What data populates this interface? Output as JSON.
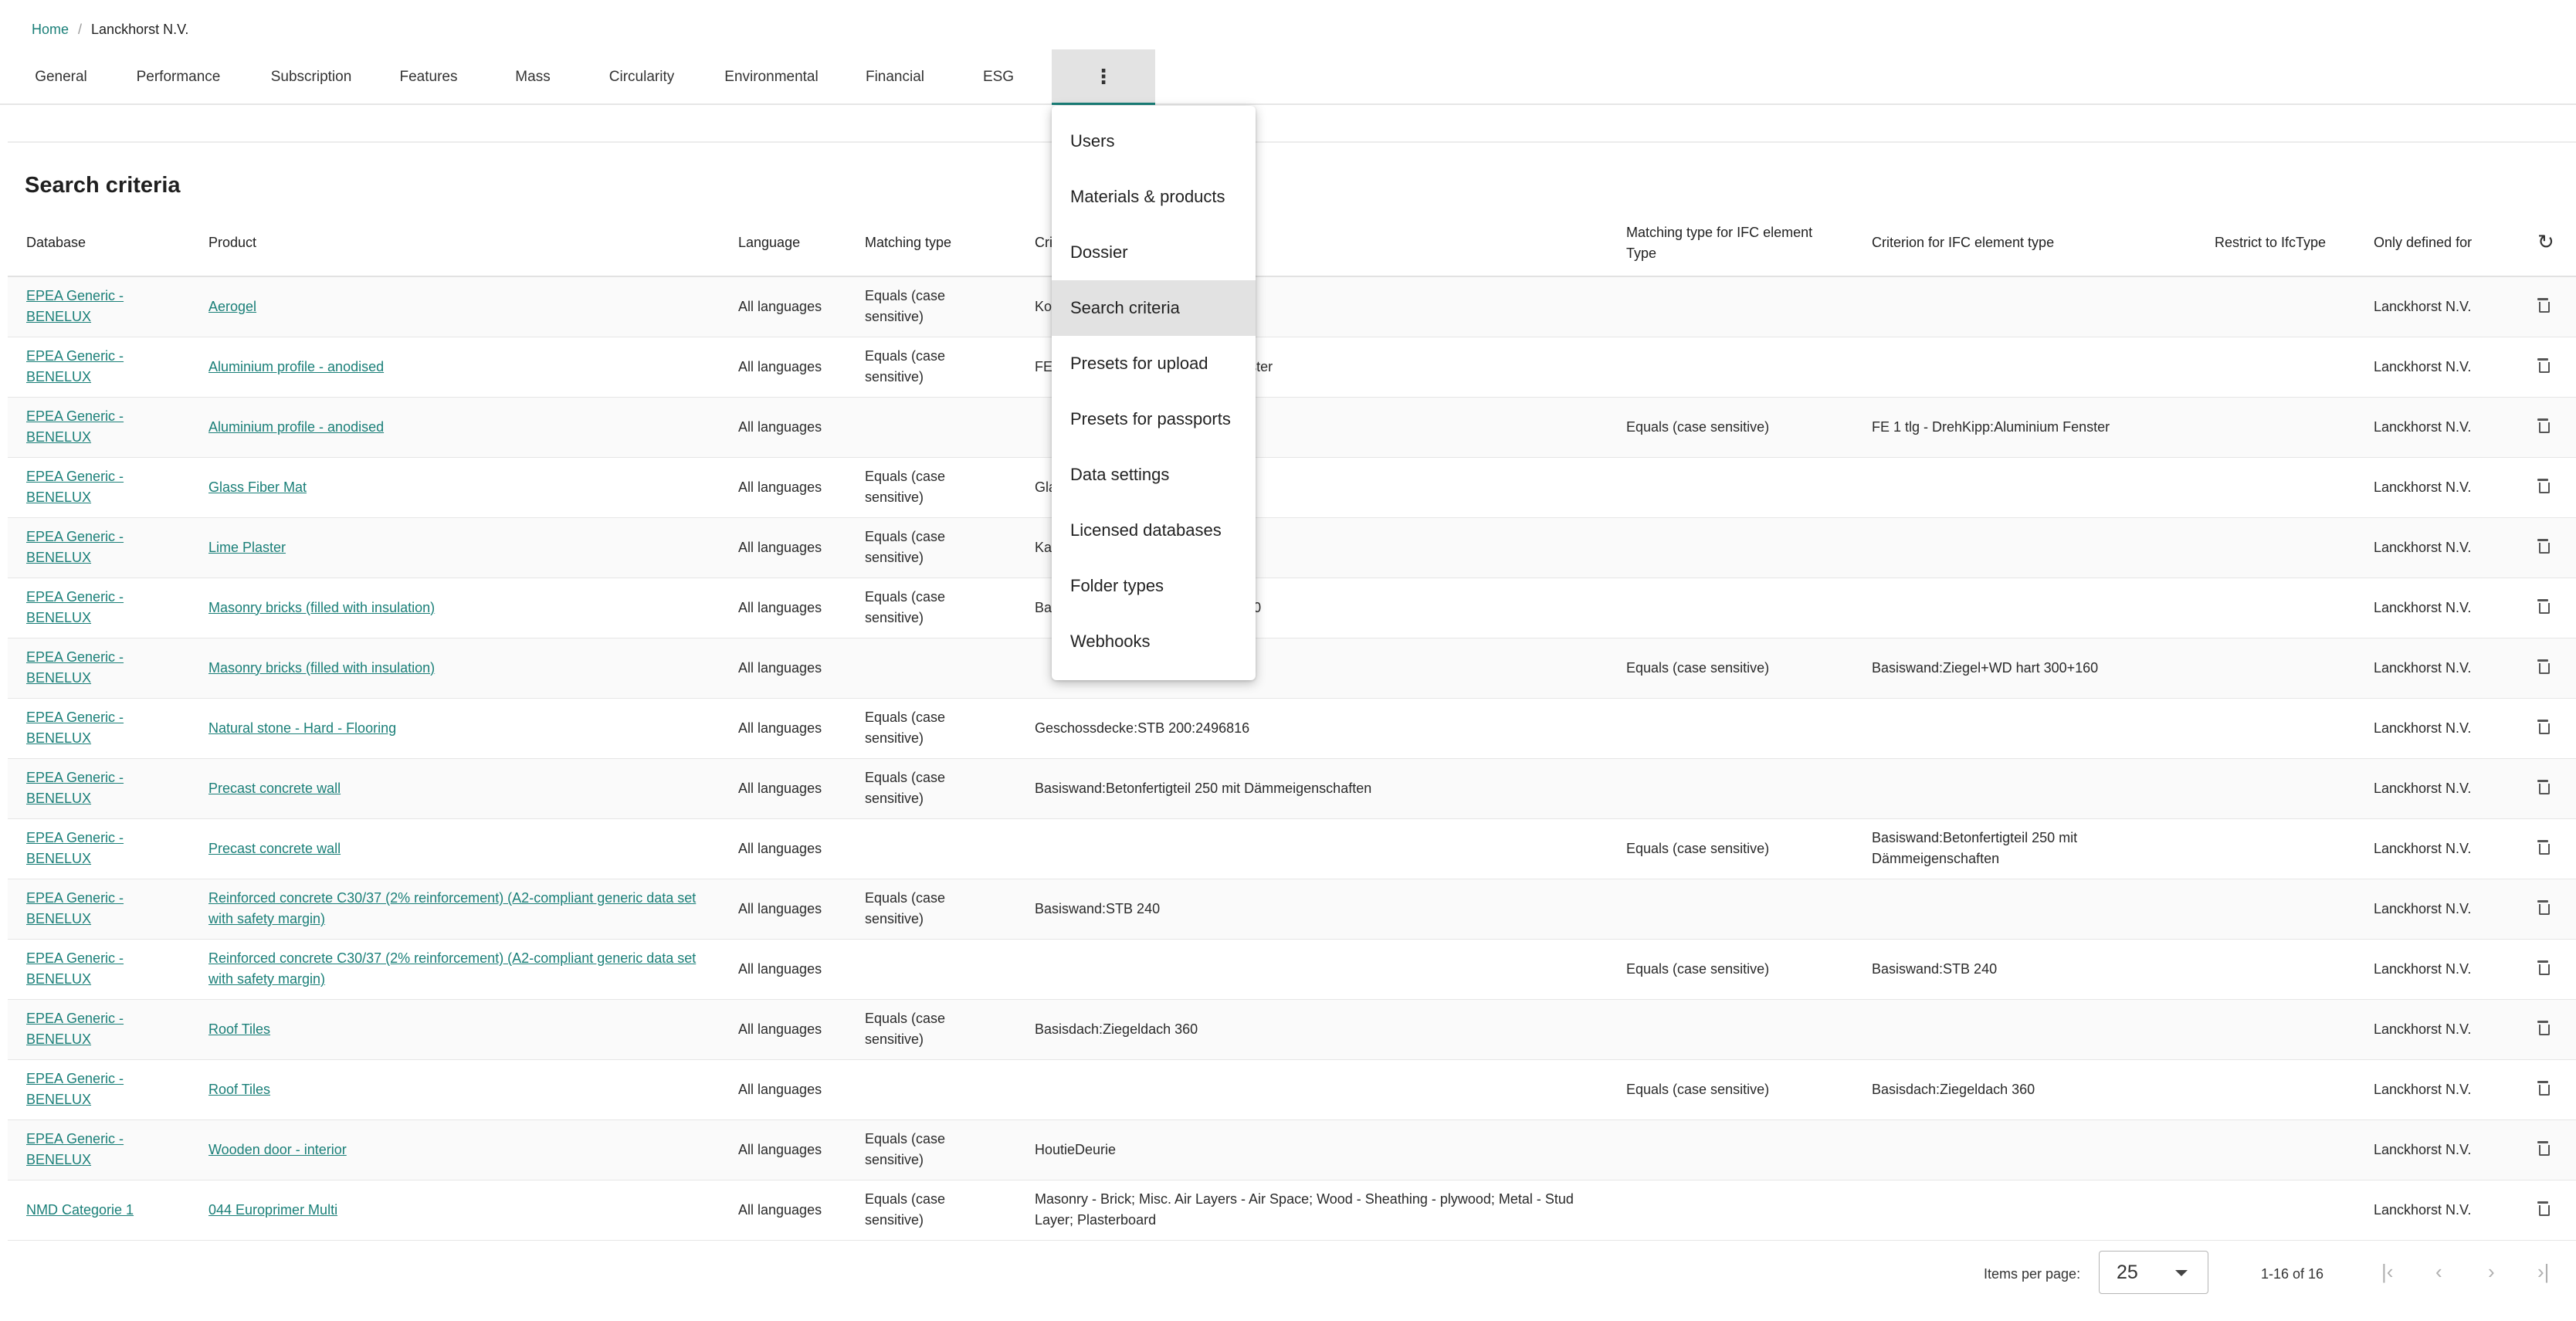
{
  "breadcrumb": {
    "home": "Home",
    "separator": "/",
    "current": "Lanckhorst N.V."
  },
  "tabs": [
    "General",
    "Performance",
    "Subscription",
    "Features",
    "Mass",
    "Circularity",
    "Environmental",
    "Financial",
    "ESG"
  ],
  "more_tab_icon": "⋮",
  "section_title": "Search criteria",
  "columns": {
    "database": "Database",
    "product": "Product",
    "language": "Language",
    "matching_type": "Matching type",
    "criterion": "Criterion",
    "matching_ifc": "Matching type for IFC element Type",
    "criterion_ifc": "Criterion for IFC element type",
    "restrict": "Restrict to IfcType",
    "only_defined": "Only defined for"
  },
  "rows": [
    {
      "database": "EPEA Generic - BENELUX",
      "product": "Aerogel",
      "language": "All languages",
      "matching_type": "Equals (case sensitive)",
      "criterion": "Ko",
      "matching_ifc": "",
      "criterion_ifc": "",
      "restrict": "",
      "only_defined": "Lanckhorst N.V."
    },
    {
      "database": "EPEA Generic - BENELUX",
      "product": "Aluminium profile - anodised",
      "language": "All languages",
      "matching_type": "Equals (case sensitive)",
      "criterion": "FE 1 tlg - DrehKipp:Aluminium Fenster",
      "matching_ifc": "",
      "criterion_ifc": "",
      "restrict": "",
      "only_defined": "Lanckhorst N.V."
    },
    {
      "database": "EPEA Generic - BENELUX",
      "product": "Aluminium profile - anodised",
      "language": "All languages",
      "matching_type": "",
      "criterion": "",
      "matching_ifc": "Equals (case sensitive)",
      "criterion_ifc": "FE 1 tlg - DrehKipp:Aluminium Fenster",
      "restrict": "",
      "only_defined": "Lanckhorst N.V."
    },
    {
      "database": "EPEA Generic - BENELUX",
      "product": "Glass Fiber Mat",
      "language": "All languages",
      "matching_type": "Equals (case sensitive)",
      "criterion": "Gla",
      "matching_ifc": "",
      "criterion_ifc": "",
      "restrict": "",
      "only_defined": "Lanckhorst N.V."
    },
    {
      "database": "EPEA Generic - BENELUX",
      "product": "Lime Plaster",
      "language": "All languages",
      "matching_type": "Equals (case sensitive)",
      "criterion": "Ka",
      "matching_ifc": "",
      "criterion_ifc": "",
      "restrict": "",
      "only_defined": "Lanckhorst N.V."
    },
    {
      "database": "EPEA Generic - BENELUX",
      "product": "Masonry bricks (filled with insulation)",
      "language": "All languages",
      "matching_type": "Equals (case sensitive)",
      "criterion": "Basiswand:Ziegel+WD hart 300+160",
      "matching_ifc": "",
      "criterion_ifc": "",
      "restrict": "",
      "only_defined": "Lanckhorst N.V."
    },
    {
      "database": "EPEA Generic - BENELUX",
      "product": "Masonry bricks (filled with insulation)",
      "language": "All languages",
      "matching_type": "",
      "criterion": "",
      "matching_ifc": "Equals (case sensitive)",
      "criterion_ifc": "Basiswand:Ziegel+WD hart 300+160",
      "restrict": "",
      "only_defined": "Lanckhorst N.V."
    },
    {
      "database": "EPEA Generic - BENELUX",
      "product": "Natural stone - Hard - Flooring",
      "language": "All languages",
      "matching_type": "Equals (case sensitive)",
      "criterion": "Geschossdecke:STB 200:2496816",
      "matching_ifc": "",
      "criterion_ifc": "",
      "restrict": "",
      "only_defined": "Lanckhorst N.V."
    },
    {
      "database": "EPEA Generic - BENELUX",
      "product": "Precast concrete wall",
      "language": "All languages",
      "matching_type": "Equals (case sensitive)",
      "criterion": "Basiswand:Betonfertigteil 250 mit Dämmeigenschaften",
      "matching_ifc": "",
      "criterion_ifc": "",
      "restrict": "",
      "only_defined": "Lanckhorst N.V."
    },
    {
      "database": "EPEA Generic - BENELUX",
      "product": "Precast concrete wall",
      "language": "All languages",
      "matching_type": "",
      "criterion": "",
      "matching_ifc": "Equals (case sensitive)",
      "criterion_ifc": "Basiswand:Betonfertigteil 250 mit Dämmeigenschaften",
      "restrict": "",
      "only_defined": "Lanckhorst N.V."
    },
    {
      "database": "EPEA Generic - BENELUX",
      "product": "Reinforced concrete C30/37 (2% reinforcement) (A2-compliant generic data set with safety margin)",
      "language": "All languages",
      "matching_type": "Equals (case sensitive)",
      "criterion": "Basiswand:STB 240",
      "matching_ifc": "",
      "criterion_ifc": "",
      "restrict": "",
      "only_defined": "Lanckhorst N.V."
    },
    {
      "database": "EPEA Generic - BENELUX",
      "product": "Reinforced concrete C30/37 (2% reinforcement) (A2-compliant generic data set with safety margin)",
      "language": "All languages",
      "matching_type": "",
      "criterion": "",
      "matching_ifc": "Equals (case sensitive)",
      "criterion_ifc": "Basiswand:STB 240",
      "restrict": "",
      "only_defined": "Lanckhorst N.V."
    },
    {
      "database": "EPEA Generic - BENELUX",
      "product": "Roof Tiles",
      "language": "All languages",
      "matching_type": "Equals (case sensitive)",
      "criterion": "Basisdach:Ziegeldach 360",
      "matching_ifc": "",
      "criterion_ifc": "",
      "restrict": "",
      "only_defined": "Lanckhorst N.V."
    },
    {
      "database": "EPEA Generic - BENELUX",
      "product": "Roof Tiles",
      "language": "All languages",
      "matching_type": "",
      "criterion": "",
      "matching_ifc": "Equals (case sensitive)",
      "criterion_ifc": "Basisdach:Ziegeldach 360",
      "restrict": "",
      "only_defined": "Lanckhorst N.V."
    },
    {
      "database": "EPEA Generic - BENELUX",
      "product": "Wooden door - interior",
      "language": "All languages",
      "matching_type": "Equals (case sensitive)",
      "criterion": "HoutieDeurie",
      "matching_ifc": "",
      "criterion_ifc": "",
      "restrict": "",
      "only_defined": "Lanckhorst N.V."
    },
    {
      "database": "NMD Categorie 1",
      "product": "044 Europrimer Multi",
      "language": "All languages",
      "matching_type": "Equals (case sensitive)",
      "criterion": "Masonry - Brick; Misc. Air Layers - Air Space; Wood - Sheathing - plywood; Metal - Stud Layer; Plasterboard",
      "matching_ifc": "",
      "criterion_ifc": "",
      "restrict": "",
      "only_defined": "Lanckhorst N.V."
    }
  ],
  "menu": [
    "Users",
    "Materials & products",
    "Dossier",
    "Search criteria",
    "Presets for upload",
    "Presets for passports",
    "Data settings",
    "Licensed databases",
    "Folder types",
    "Webhooks"
  ],
  "menu_active": "Search criteria",
  "paginator": {
    "label": "Items per page:",
    "page_size": "25",
    "range": "1-16 of 16",
    "first": "|‹",
    "prev": "‹",
    "next": "›",
    "last": "›|"
  },
  "icons": {
    "refresh": "refresh-icon",
    "delete": "trash-icon",
    "more": "vertical-dots-icon"
  },
  "colors": {
    "accent": "#1a7f78",
    "menu_active_bg": "#e2e2e2"
  }
}
